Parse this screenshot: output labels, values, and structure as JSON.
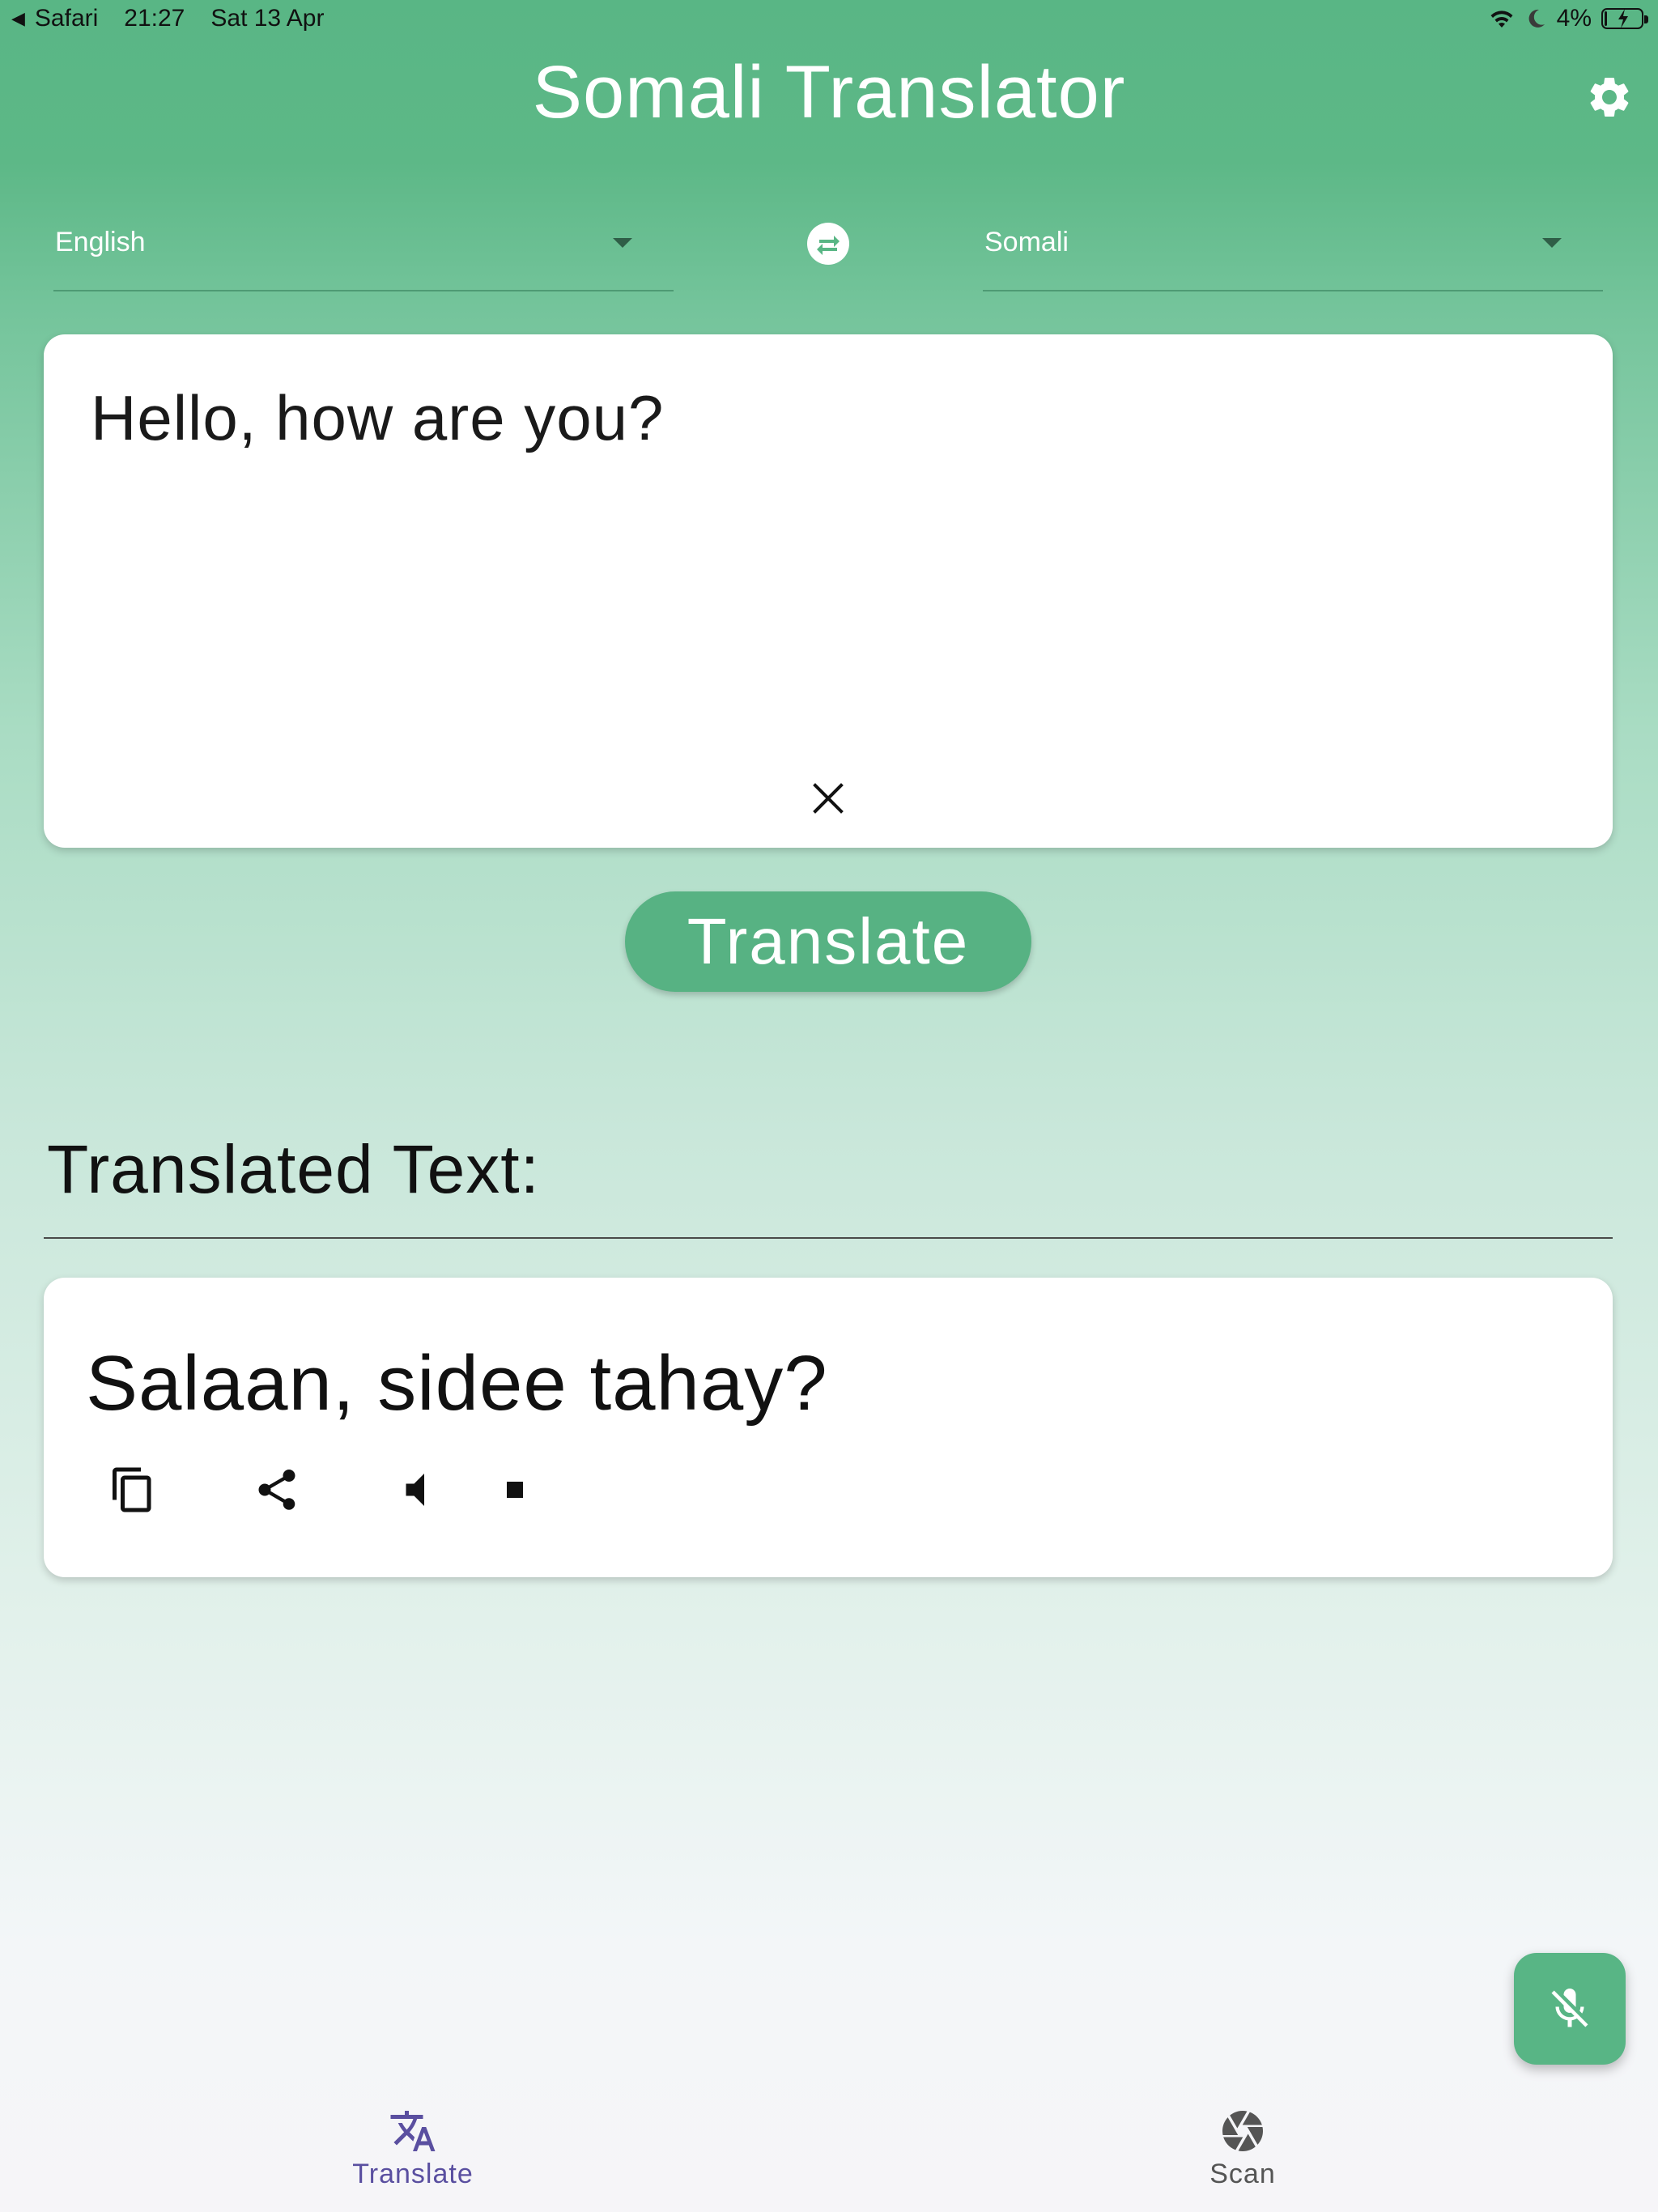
{
  "status_bar": {
    "back_app": "Safari",
    "time": "21:27",
    "date": "Sat 13 Apr",
    "battery": "4%",
    "battery_level": 0.04
  },
  "header": {
    "title": "Somali Translator"
  },
  "language_selector": {
    "source": "English",
    "target": "Somali"
  },
  "input": {
    "text": "Hello, how are you?"
  },
  "actions": {
    "translate_label": "Translate"
  },
  "output": {
    "heading": "Translated Text:",
    "text": "Salaan, sidee tahay?"
  },
  "bottom_nav": {
    "items": [
      {
        "label": "Translate",
        "icon": "translate-icon",
        "active": true
      },
      {
        "label": "Scan",
        "icon": "camera-shutter-icon",
        "active": false
      }
    ]
  },
  "colors": {
    "primary": "#57b283",
    "nav_active": "#5a4fa0"
  }
}
